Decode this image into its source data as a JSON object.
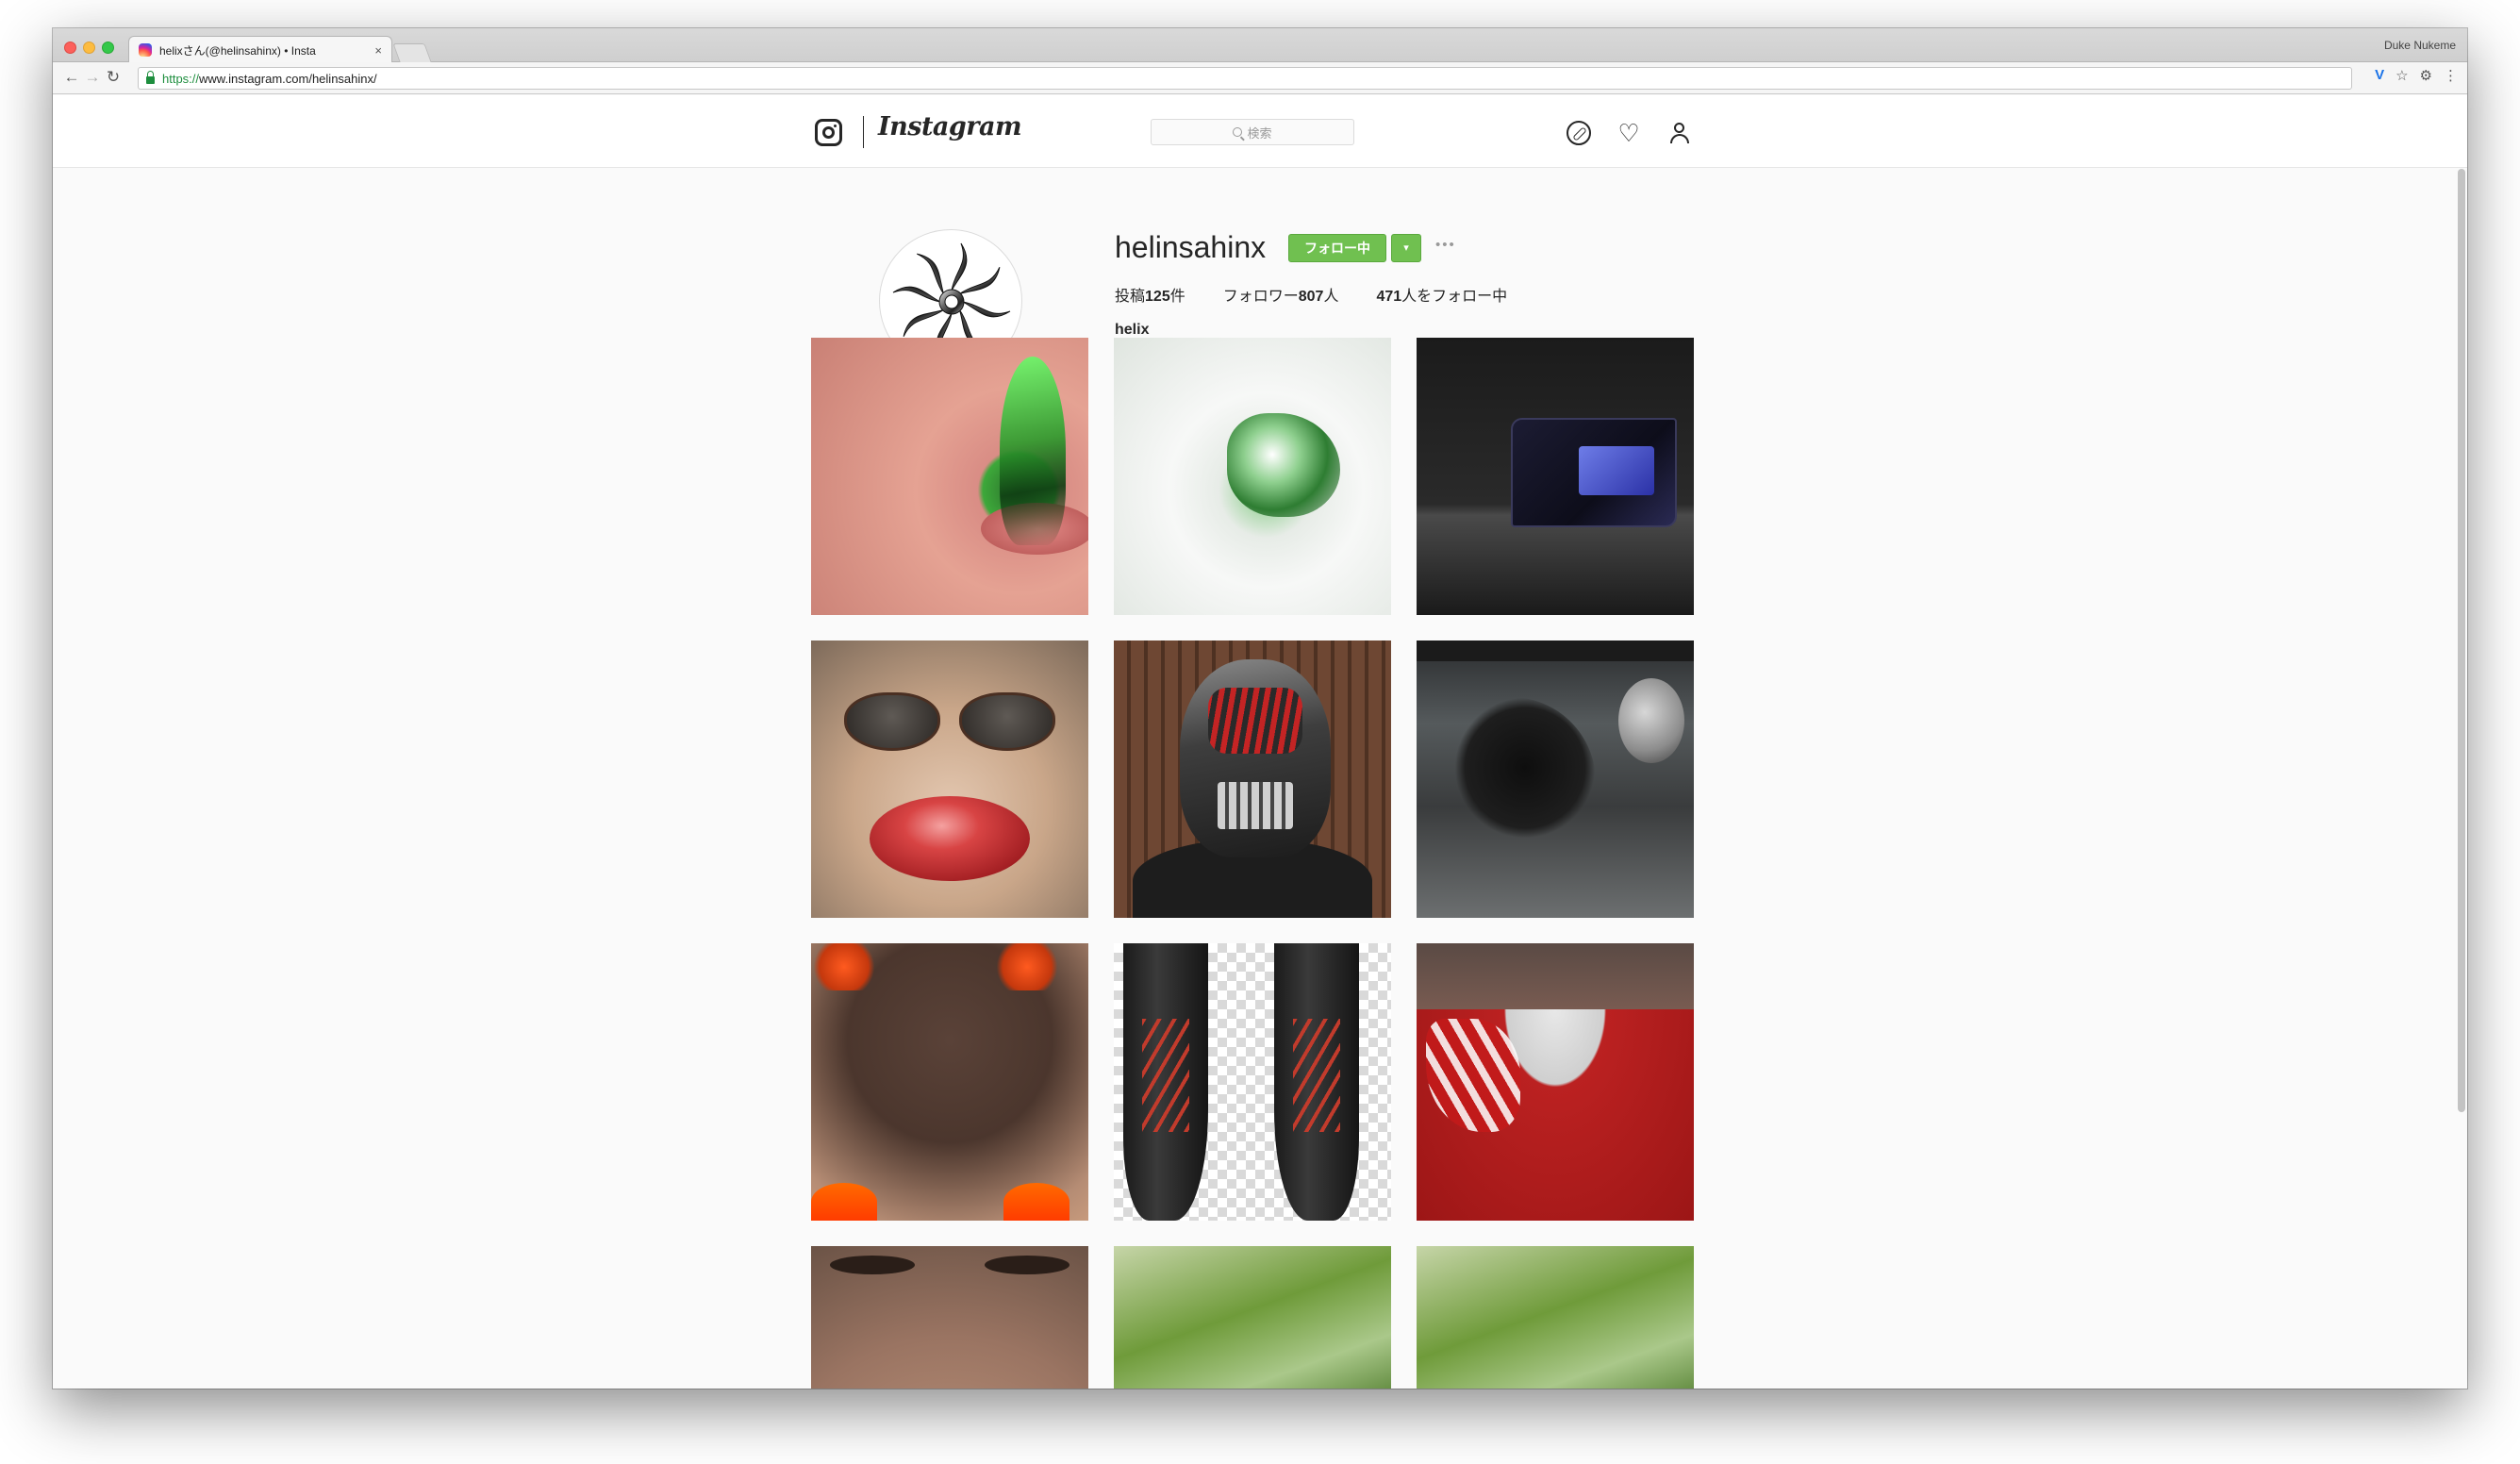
{
  "browser": {
    "tab_title": "helixさん(@helinsahinx) • Insta",
    "tab_close": "×",
    "profile_name": "Duke Nukeme",
    "url_secure": "https://",
    "url_rest": "www.instagram.com/helinsahinx/",
    "nav": {
      "back": "←",
      "forward": "→",
      "reload": "↻"
    },
    "ext_icons": {
      "ext": "V",
      "star": "☆",
      "settings": "⚙",
      "menu": "⋮"
    }
  },
  "header": {
    "wordmark": "Instagram",
    "search_placeholder": "検索",
    "icons": [
      "camera-icon",
      "compass-icon",
      "heart-icon",
      "person-icon"
    ]
  },
  "profile": {
    "username": "helinsahinx",
    "follow_button": "フォロー中",
    "dropdown": "▾",
    "more": "•••",
    "stats": {
      "posts_label": "投稿",
      "posts_count": "125",
      "posts_unit": "件",
      "followers_label": "フォロワー",
      "followers_count": "807",
      "followers_unit": "人",
      "following_count": "471",
      "following_label": "人をフォロー中"
    },
    "full_name": "helix"
  },
  "colors": {
    "follow_green": "#70c050",
    "text": "#262626",
    "secure_green": "#1e8e3e"
  }
}
